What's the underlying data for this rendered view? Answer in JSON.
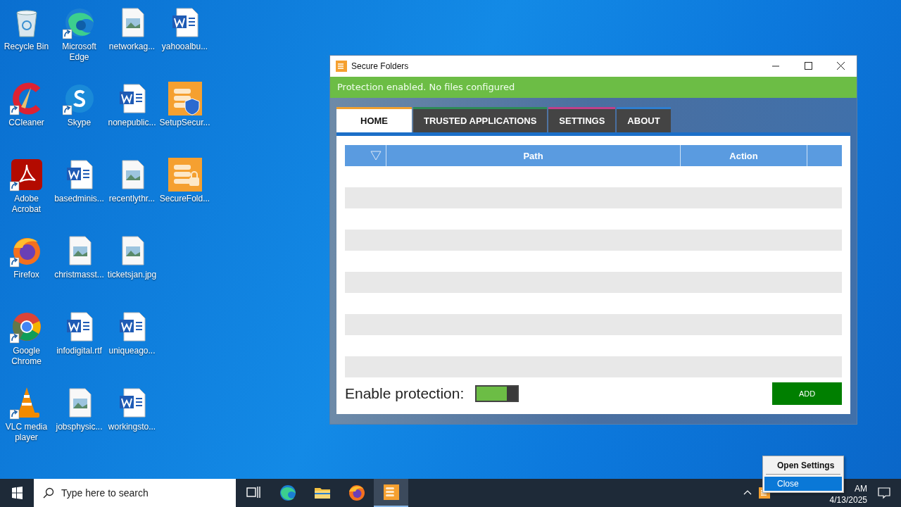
{
  "desktop_icons": [
    {
      "label": "Recycle Bin",
      "kind": "recyclebin",
      "shortcut": false
    },
    {
      "label": "CCleaner",
      "kind": "ccleaner",
      "shortcut": true
    },
    {
      "label": "Adobe Acrobat",
      "kind": "acrobat",
      "shortcut": true
    },
    {
      "label": "Firefox",
      "kind": "firefox",
      "shortcut": true
    },
    {
      "label": "Google Chrome",
      "kind": "chrome",
      "shortcut": true
    },
    {
      "label": "VLC media player",
      "kind": "vlc",
      "shortcut": true
    },
    {
      "label": "Microsoft Edge",
      "kind": "edge",
      "shortcut": true
    },
    {
      "label": "Skype",
      "kind": "skype",
      "shortcut": true
    },
    {
      "label": "basedminis...",
      "kind": "word",
      "shortcut": false
    },
    {
      "label": "christmasst...",
      "kind": "image",
      "shortcut": false
    },
    {
      "label": "infodigital.rtf",
      "kind": "word",
      "shortcut": false
    },
    {
      "label": "jobsphysic...",
      "kind": "image",
      "shortcut": false
    },
    {
      "label": "networkag...",
      "kind": "image",
      "shortcut": false
    },
    {
      "label": "nonepublic...",
      "kind": "word",
      "shortcut": false
    },
    {
      "label": "recentlythr...",
      "kind": "image",
      "shortcut": false
    },
    {
      "label": "ticketsjan.jpg",
      "kind": "image",
      "shortcut": false
    },
    {
      "label": "uniqueago...",
      "kind": "word",
      "shortcut": false
    },
    {
      "label": "workingsto...",
      "kind": "word",
      "shortcut": false
    },
    {
      "label": "yahooalbu...",
      "kind": "word",
      "shortcut": false
    },
    {
      "label": "SetupSecur...",
      "kind": "installer",
      "shortcut": false
    },
    {
      "label": "SecureFold...",
      "kind": "lockapp",
      "shortcut": false
    }
  ],
  "window": {
    "title": "Secure Folders",
    "status": "Protection enabled. No files configured",
    "tabs": [
      {
        "label": "HOME",
        "selected": true,
        "color": "#f0a030"
      },
      {
        "label": "TRUSTED APPLICATIONS",
        "selected": false,
        "color": "#2e8b57"
      },
      {
        "label": "SETTINGS",
        "selected": false,
        "color": "#c0408a"
      },
      {
        "label": "ABOUT",
        "selected": false,
        "color": "#2f7fd0"
      }
    ],
    "table": {
      "columns": [
        "Path",
        "Action"
      ]
    },
    "protection_label": "Enable protection:",
    "protection_on": true,
    "add_button": "ADD"
  },
  "taskbar": {
    "search_placeholder": "Type here to search",
    "apps": [
      {
        "kind": "taskview",
        "selected": false
      },
      {
        "kind": "edge",
        "selected": false
      },
      {
        "kind": "folder",
        "selected": false
      },
      {
        "kind": "firefox",
        "selected": false
      },
      {
        "kind": "lockapp",
        "selected": true
      }
    ],
    "clock": {
      "time": "AM",
      "date": "4/13/2025"
    }
  },
  "context_menu": {
    "items": [
      {
        "label": "Open Settings",
        "bold": true,
        "selected": false
      },
      {
        "label": "Close",
        "bold": false,
        "selected": true
      }
    ]
  }
}
